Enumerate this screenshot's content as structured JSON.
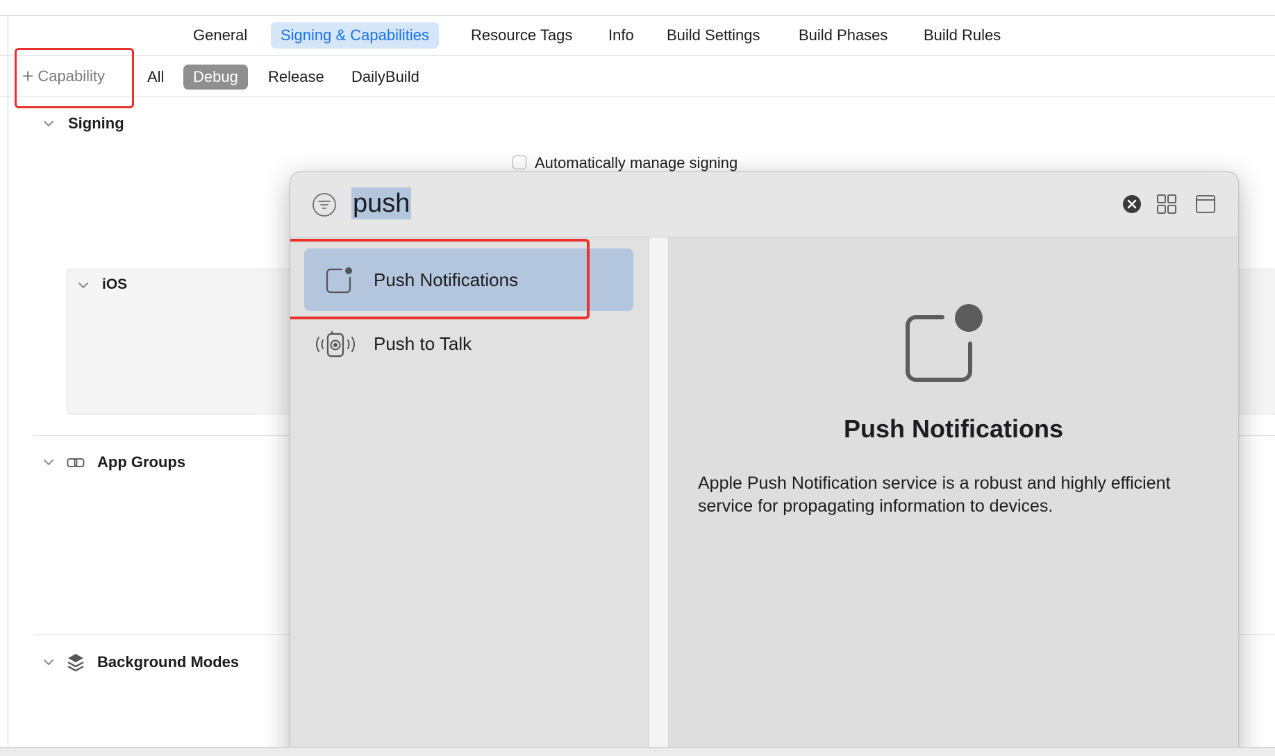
{
  "tabs": {
    "general": "General",
    "signing": "Signing & Capabilities",
    "resource_tags": "Resource Tags",
    "info": "Info",
    "build_settings": "Build Settings",
    "build_phases": "Build Phases",
    "build_rules": "Build Rules"
  },
  "config": {
    "capability_button": "Capability",
    "all": "All",
    "debug": "Debug",
    "release": "Release",
    "dailybuild": "DailyBuild",
    "selected": "Debug"
  },
  "signing": {
    "title": "Signing",
    "auto_manage_label": "Automatically manage signing",
    "auto_manage_checked": false
  },
  "ios_section": {
    "title": "iOS"
  },
  "sections": {
    "app_groups": "App Groups",
    "background_modes": "Background Modes"
  },
  "popover": {
    "search_value": "push",
    "results": [
      {
        "label": "Push Notifications",
        "icon": "push-notifications-icon",
        "selected": true
      },
      {
        "label": "Push to Talk",
        "icon": "walkie-talkie-icon",
        "selected": false
      }
    ],
    "detail": {
      "title": "Push Notifications",
      "description": "Apple Push Notification service is a robust and highly efficient service for propagating information to devices."
    }
  },
  "colors": {
    "accent": "#1a73e8",
    "active_tab_bg": "#d5e6f9",
    "selection_bg": "#b3c6dd",
    "highlight_red": "#e8322e",
    "segment_selected": "#8f8f8f"
  }
}
